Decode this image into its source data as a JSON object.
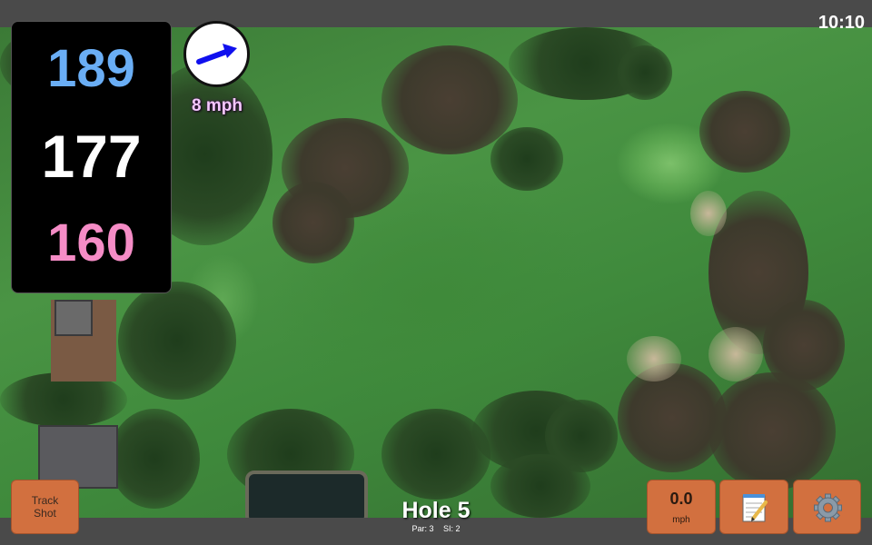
{
  "status": {
    "time": "10:10"
  },
  "distances": {
    "back": "189",
    "middle": "177",
    "front": "160"
  },
  "wind": {
    "speed_label": "8 mph",
    "icon": "wind-arrow-icon",
    "arrow_color": "#1010ee"
  },
  "track_shot": {
    "line1": "Track",
    "line2": "Shot"
  },
  "speed_display": {
    "value": "0.0",
    "unit": "mph"
  },
  "notes_button": {
    "icon": "notepad-icon"
  },
  "settings_button": {
    "icon": "gear-icon"
  },
  "hole": {
    "title": "Hole 5",
    "par": "Par: 3",
    "si": "SI: 2"
  },
  "colors": {
    "button": "#d2703f",
    "back_distance": "#6aaef5",
    "front_distance": "#f58cc6",
    "middle_distance": "#ffffff",
    "bar": "#4a4a4a"
  }
}
